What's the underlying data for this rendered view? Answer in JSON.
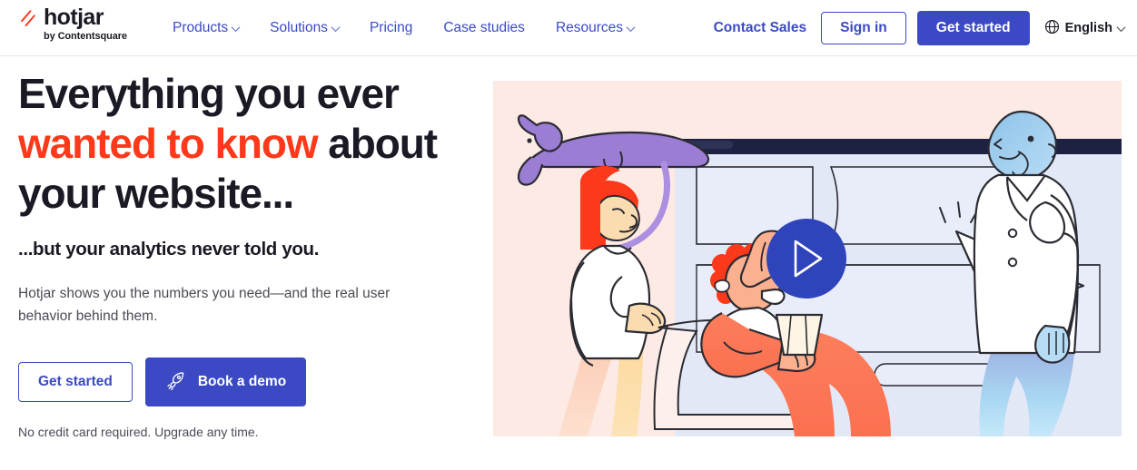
{
  "header": {
    "logo": {
      "mark_icon": "hotjar-flame-icon",
      "wordmark": "hotjar",
      "byline": "by Contentsquare"
    },
    "nav": [
      {
        "label": "Products",
        "has_dropdown": true,
        "icon": "chevron-down-icon"
      },
      {
        "label": "Solutions",
        "has_dropdown": true,
        "icon": "chevron-down-icon"
      },
      {
        "label": "Pricing",
        "has_dropdown": false
      },
      {
        "label": "Case studies",
        "has_dropdown": false
      },
      {
        "label": "Resources",
        "has_dropdown": true,
        "icon": "chevron-down-icon"
      }
    ],
    "contact_sales": "Contact Sales",
    "sign_in": "Sign in",
    "get_started": "Get started",
    "language": {
      "icon": "globe-icon",
      "label": "English",
      "chevron": "chevron-down-icon"
    }
  },
  "hero": {
    "headline": {
      "line1": "Everything you ever",
      "line2_accent": "wanted to know",
      "line2_rest": " about",
      "line3": "your website..."
    },
    "subhead": "...but your analytics never told you.",
    "body": "Hotjar shows you the numbers you need—and the real user behavior behind them.",
    "cta_primary": "Get started",
    "cta_secondary": "Book a demo",
    "cta_secondary_icon": "rocket-icon",
    "fineprint": "No credit card required. Upgrade any time.",
    "illustration": {
      "alt": "Three illustrated people looking at a website on a large screen with a purple cat lying on top, a video play button overlay and a large cursor arrow clicking the page",
      "play_button_icon": "play-icon"
    }
  },
  "colors": {
    "brand_blue": "#3b4ac4",
    "accent_orange": "#fc391a",
    "ink": "#1a1a24",
    "muted_text": "#4b4b57",
    "art_background": "#fdeae4",
    "screen_fill": "#e3e8f7",
    "screen_bar": "#1d2243",
    "cat_purple": "#9b7dd4",
    "skin_blue": "#a8cdf0",
    "coral": "#fc7a5a",
    "sand": "#fad9a0",
    "border_grey": "#e6e6e6"
  }
}
